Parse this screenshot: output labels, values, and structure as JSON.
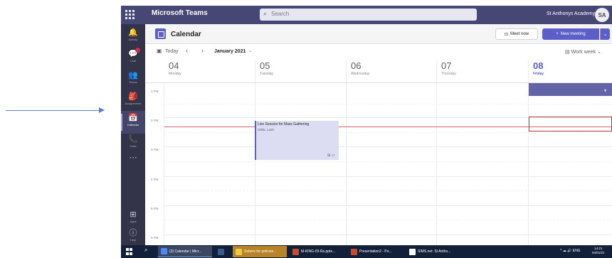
{
  "window": {
    "title": "Microsoft Teams"
  },
  "topbar": {
    "brand": "Microsoft Teams",
    "search_placeholder": "Search",
    "org_name": "St Anthonys Academy",
    "avatar_initials": "SA",
    "accent": "#464775"
  },
  "rail": {
    "items": [
      {
        "label": "Activity",
        "icon": "bell-icon",
        "glyph": "🔔",
        "badge": false
      },
      {
        "label": "Chat",
        "icon": "chat-icon",
        "glyph": "💬",
        "badge": true
      },
      {
        "label": "Teams",
        "icon": "teams-icon",
        "glyph": "👥",
        "badge": false
      },
      {
        "label": "Assignments",
        "icon": "assignments-icon",
        "glyph": "🎒",
        "badge": false
      },
      {
        "label": "Calendar",
        "icon": "calendar-icon",
        "glyph": "📅",
        "badge": false,
        "active": true
      },
      {
        "label": "Calls",
        "icon": "phone-icon",
        "glyph": "📞",
        "badge": false
      },
      {
        "label": "",
        "icon": "more-icon",
        "glyph": "⋯",
        "badge": false
      }
    ],
    "bottom": [
      {
        "label": "Apps",
        "icon": "apps-icon",
        "glyph": "⊞"
      },
      {
        "label": "Help",
        "icon": "help-icon",
        "glyph": "ⓘ"
      }
    ]
  },
  "header": {
    "title": "Calendar",
    "meet_now": "Meet now",
    "new_meeting": "New meeting",
    "brand_color": "#5b5fc7"
  },
  "toolbar": {
    "today": "Today",
    "month": "January 2021",
    "view": "Work week"
  },
  "days": [
    {
      "num": "04",
      "name": "Monday",
      "today": false
    },
    {
      "num": "05",
      "name": "Tuesday",
      "today": false
    },
    {
      "num": "06",
      "name": "Wednesday",
      "today": false
    },
    {
      "num": "07",
      "name": "Thursday",
      "today": false
    },
    {
      "num": "08",
      "name": "Friday",
      "today": true
    }
  ],
  "times": [
    "1 PM",
    "2 PM",
    "3 PM",
    "4 PM",
    "5 PM",
    "6 PM"
  ],
  "events": [
    {
      "title": "Live Session for Mass Gathering",
      "organizer": "Ottila, Leah"
    }
  ],
  "taskbar": {
    "apps": [
      {
        "label": "(3) Calendar | Micr...",
        "color": "#4a8af4"
      },
      {
        "label": "",
        "color": "#3b5b8c"
      },
      {
        "label": "Sobers for policies...",
        "color": "#f2c744",
        "highlight": true
      },
      {
        "label": "M-KING-03-Rs.pptx...",
        "color": "#d24726"
      },
      {
        "label": "Presentation2 - Po...",
        "color": "#d24726"
      },
      {
        "label": "SIMS.net: St Antho...",
        "color": "#ffffff"
      }
    ],
    "tray": "^ ☁ 🔊 ENG",
    "time": "14:21",
    "date": "04/01/21"
  }
}
